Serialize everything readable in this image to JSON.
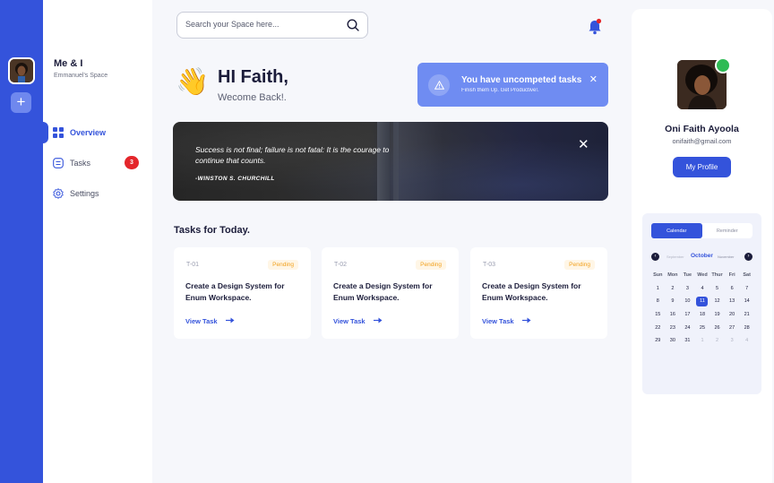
{
  "rail": {
    "add_label": "+"
  },
  "space": {
    "title": "Me & I",
    "subtitle": "Emmanuel's Space"
  },
  "nav": {
    "overview": "Overview",
    "tasks": "Tasks",
    "tasks_badge": "3",
    "settings": "Settings"
  },
  "search": {
    "placeholder": "Search your Space here..."
  },
  "greeting": {
    "title": "HI Faith,",
    "subtitle": "Wecome Back!."
  },
  "alert": {
    "title": "You have uncompeted tasks",
    "subtitle": "Finish them Up. Get Productive!."
  },
  "quote": {
    "text": "Success is not final; failure is not fatal: It is the courage to continue that counts.",
    "author": "-WINSTON S. CHURCHILL"
  },
  "tasks": {
    "title": "Tasks for Today.",
    "items": [
      {
        "id": "T-01",
        "status": "Pending",
        "name": "Create a Design System for Enum Workspace.",
        "link": "View Task"
      },
      {
        "id": "T-02",
        "status": "Pending",
        "name": "Create a Design System for Enum Workspace.",
        "link": "View Task"
      },
      {
        "id": "T-03",
        "status": "Pending",
        "name": "Create a Design System for Enum Workspace.",
        "link": "View Task"
      }
    ]
  },
  "profile": {
    "name": "Oni Faith Ayoola",
    "email": "onifaith@gmail.com",
    "button": "My Profile"
  },
  "calendar": {
    "tabs": [
      "Calendar",
      "Reminder"
    ],
    "prev_month": "September",
    "month": "October",
    "next_month": "November",
    "weekdays": [
      "Sun",
      "Mon",
      "Tue",
      "Wed",
      "Thur",
      "Fri",
      "Sat"
    ],
    "weeks": [
      [
        "",
        "",
        "",
        "",
        "",
        "",
        ""
      ],
      [
        "1",
        "2",
        "3",
        "4",
        "5",
        "6",
        "7"
      ],
      [
        "8",
        "9",
        "10",
        "11",
        "12",
        "13",
        "14"
      ],
      [
        "15",
        "16",
        "17",
        "18",
        "19",
        "20",
        "21"
      ],
      [
        "22",
        "23",
        "24",
        "25",
        "26",
        "27",
        "28"
      ],
      [
        "29",
        "30",
        "31",
        "1",
        "2",
        "3",
        "4"
      ]
    ],
    "selected_day": "11"
  },
  "colors": {
    "primary": "#3453db",
    "alert": "#6f8cf2",
    "badge": "#e4262b",
    "pending": "#f2a11d",
    "online": "#2fbb55"
  }
}
